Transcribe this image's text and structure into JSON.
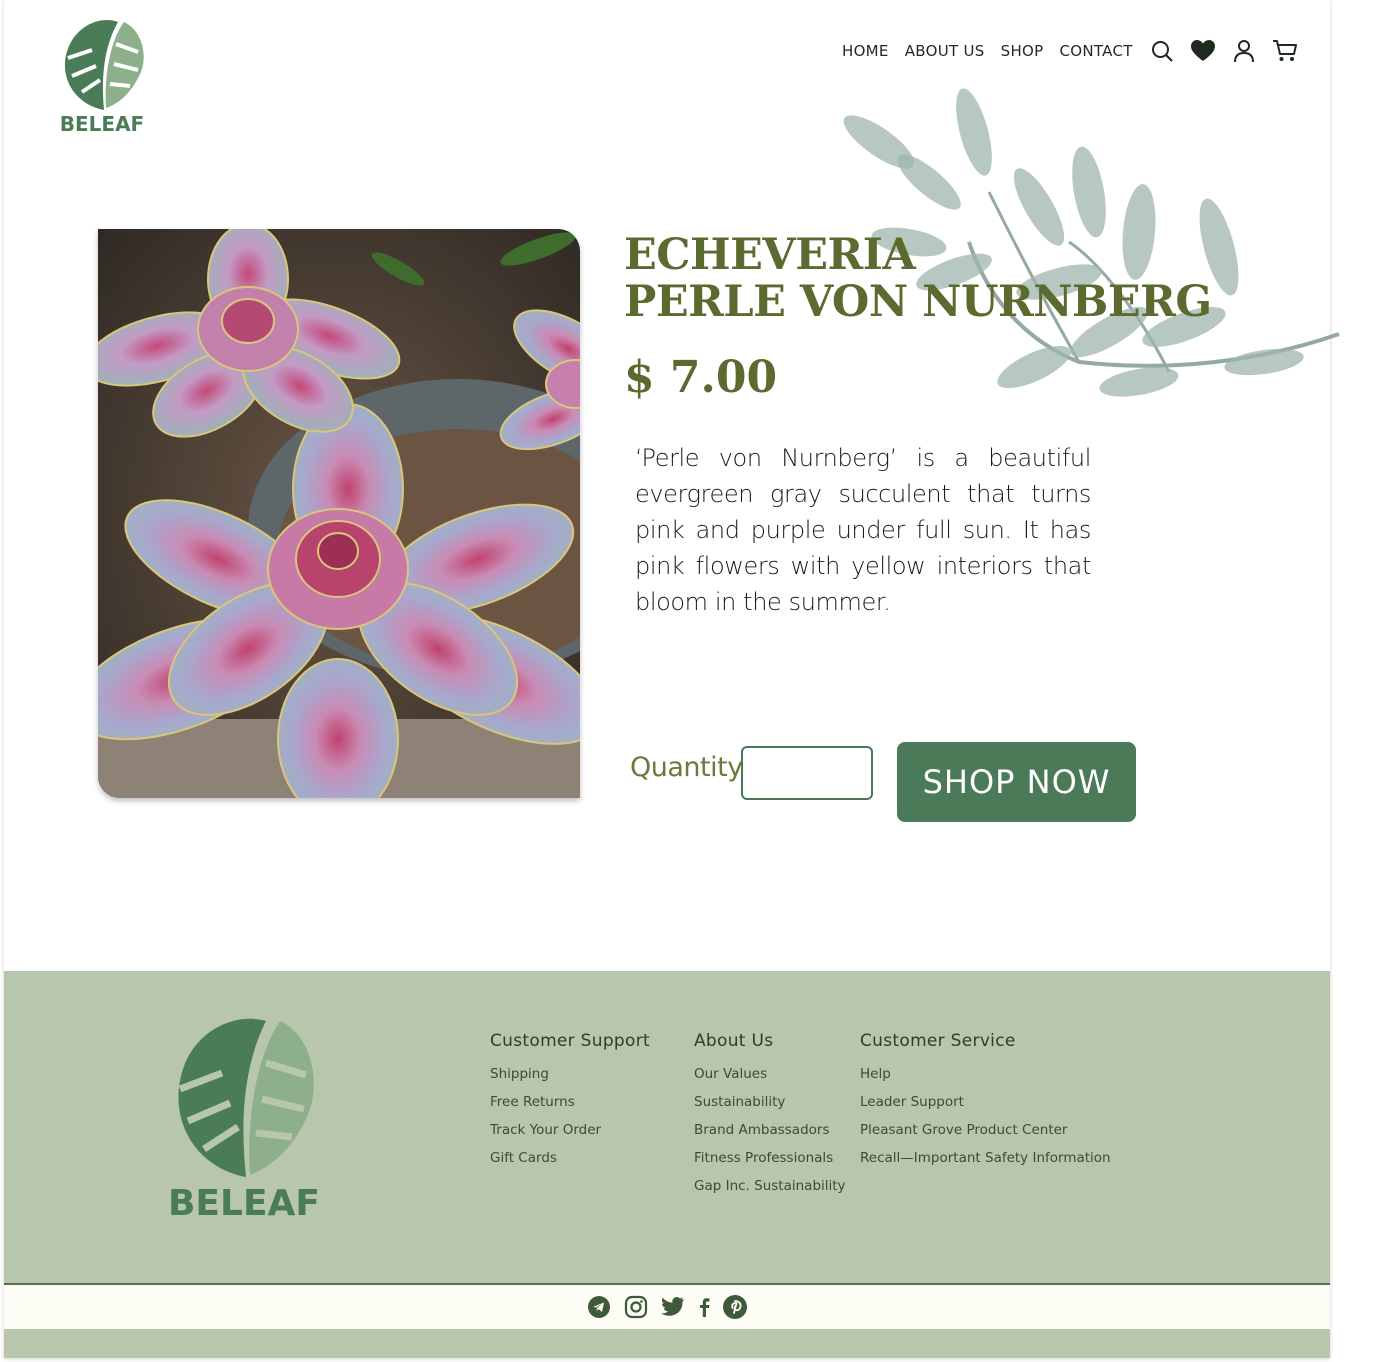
{
  "brand": {
    "name": "BELEAF"
  },
  "nav": {
    "items": [
      "HOME",
      "ABOUT US",
      "SHOP",
      "CONTACT"
    ],
    "icons": [
      "search-icon",
      "heart-icon",
      "user-icon",
      "cart-icon"
    ]
  },
  "product": {
    "title_line1": "ECHEVERIA",
    "title_line2": "PERLE VON NURNBERG",
    "price": "$ 7.00",
    "description": "‘Perle von Nurnberg’ is a beautiful evergreen gray succulent that turns pink and purple under full sun. It has pink flowers with yellow interiors that bloom in the summer.",
    "quantity_label": "Quantity",
    "quantity_value": "",
    "shop_button": "SHOP NOW"
  },
  "footer": {
    "columns": [
      {
        "heading": "Customer Support",
        "links": [
          "Shipping",
          "Free Returns",
          "Track Your Order",
          "Gift Cards"
        ]
      },
      {
        "heading": "About Us",
        "links": [
          "Our Values",
          "Sustainability",
          "Brand Ambassadors",
          "Fitness Professionals",
          "Gap Inc. Sustainability"
        ]
      },
      {
        "heading": "Customer Service",
        "links": [
          "Help",
          "Leader Support",
          "Pleasant Grove Product Center",
          "Recall—Important Safety Information"
        ]
      }
    ],
    "social": [
      "telegram-icon",
      "instagram-icon",
      "twitter-icon",
      "facebook-icon",
      "pinterest-icon"
    ]
  },
  "colors": {
    "accent_green": "#4b7a58",
    "olive": "#5b6b2f",
    "footer_bg": "#b7c6ad",
    "social_bar_bg": "#fdfcf5"
  }
}
